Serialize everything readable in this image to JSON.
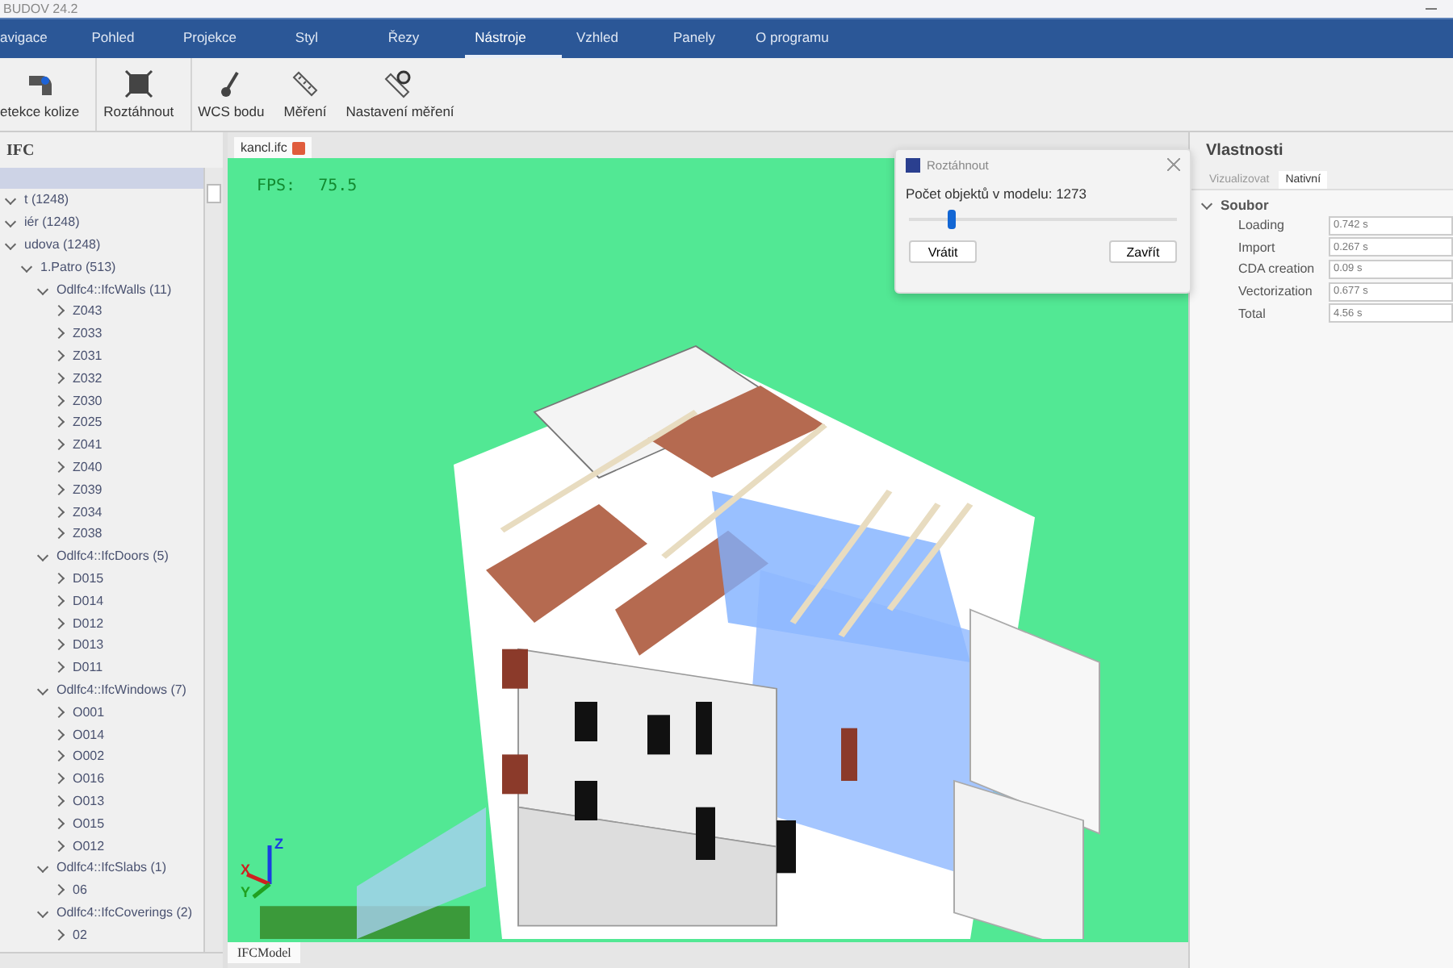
{
  "window": {
    "title": "BUDOV 24.2"
  },
  "menu": [
    {
      "label": "avigace",
      "selected": false
    },
    {
      "label": "Pohled",
      "selected": false
    },
    {
      "label": "Projekce",
      "selected": false
    },
    {
      "label": "Styl",
      "selected": false
    },
    {
      "label": "Řezy",
      "selected": false
    },
    {
      "label": "Nástroje",
      "selected": true
    },
    {
      "label": "Vzhled",
      "selected": false
    },
    {
      "label": "Panely",
      "selected": false
    },
    {
      "label": "O programu",
      "selected": false
    }
  ],
  "ribbon_groups": [
    {
      "buttons": [
        {
          "label": "etekce kolize",
          "kind": "collision"
        }
      ]
    },
    {
      "buttons": [
        {
          "label": "Roztáhnout",
          "kind": "explode"
        }
      ]
    },
    {
      "buttons": [
        {
          "label": "WCS bodu",
          "kind": "pin"
        },
        {
          "label": "Měření",
          "kind": "ruler"
        },
        {
          "label": "Nastavení měření",
          "kind": "ruler-settings"
        }
      ]
    }
  ],
  "left_panel": {
    "title": "IFC",
    "tree": [
      {
        "label": "t (1248)",
        "expanded": true,
        "children": [
          {
            "label": "iér (1248)",
            "expanded": true,
            "children": [
              {
                "label": "udova (1248)",
                "expanded": true,
                "children": [
                  {
                    "label": "1.Patro (513)",
                    "expanded": true,
                    "children": [
                      {
                        "label": "Odlfc4::IfcWalls (11)",
                        "expanded": true,
                        "children": [
                          {
                            "label": "Z043",
                            "expanded": false
                          },
                          {
                            "label": "Z033",
                            "expanded": false
                          },
                          {
                            "label": "Z031",
                            "expanded": false
                          },
                          {
                            "label": "Z032",
                            "expanded": false
                          },
                          {
                            "label": "Z030",
                            "expanded": false
                          },
                          {
                            "label": "Z025",
                            "expanded": false
                          },
                          {
                            "label": "Z041",
                            "expanded": false
                          },
                          {
                            "label": "Z040",
                            "expanded": false
                          },
                          {
                            "label": "Z039",
                            "expanded": false
                          },
                          {
                            "label": "Z034",
                            "expanded": false
                          },
                          {
                            "label": "Z038",
                            "expanded": false
                          }
                        ]
                      },
                      {
                        "label": "Odlfc4::IfcDoors (5)",
                        "expanded": true,
                        "children": [
                          {
                            "label": "D015",
                            "expanded": false
                          },
                          {
                            "label": "D014",
                            "expanded": false
                          },
                          {
                            "label": "D012",
                            "expanded": false
                          },
                          {
                            "label": "D013",
                            "expanded": false
                          },
                          {
                            "label": "D011",
                            "expanded": false
                          }
                        ]
                      },
                      {
                        "label": "Odlfc4::IfcWindows (7)",
                        "expanded": true,
                        "children": [
                          {
                            "label": "O001",
                            "expanded": false
                          },
                          {
                            "label": "O014",
                            "expanded": false
                          },
                          {
                            "label": "O002",
                            "expanded": false
                          },
                          {
                            "label": "O016",
                            "expanded": false
                          },
                          {
                            "label": "O013",
                            "expanded": false
                          },
                          {
                            "label": "O015",
                            "expanded": false
                          },
                          {
                            "label": "O012",
                            "expanded": false
                          }
                        ]
                      },
                      {
                        "label": "Odlfc4::IfcSlabs (1)",
                        "expanded": true,
                        "children": [
                          {
                            "label": "06",
                            "expanded": false
                          }
                        ]
                      },
                      {
                        "label": "Odlfc4::IfcCoverings (2)",
                        "expanded": true,
                        "children": [
                          {
                            "label": "02",
                            "expanded": false
                          }
                        ]
                      }
                    ]
                  }
                ]
              }
            ]
          }
        ]
      }
    ]
  },
  "document_tab": {
    "label": "kancl.ifc"
  },
  "viewport": {
    "fps_label": "FPS:",
    "fps": "75.5",
    "axes": [
      "X",
      "Y",
      "Z"
    ]
  },
  "bottom_tab": {
    "label": "IFCModel"
  },
  "dialog": {
    "title": "Roztáhnout",
    "message": "Počet objektů v modelu: 1273",
    "level": 0.16,
    "buttons": [
      "Vrátit",
      "Zavřít"
    ]
  },
  "properties": {
    "title": "Vlastnosti",
    "tabs": [
      {
        "label": "Vizualizovat",
        "selected": false
      },
      {
        "label": "Nativní",
        "selected": true
      }
    ],
    "group": {
      "label": "Soubor",
      "expanded": true
    },
    "rows": [
      {
        "name": "Loading",
        "value": "0.742 s"
      },
      {
        "name": "Import",
        "value": "0.267 s"
      },
      {
        "name": "CDA creation",
        "value": "0.09 s"
      },
      {
        "name": "Vectorization",
        "value": "0.677 s"
      },
      {
        "name": "Total",
        "value": "4.56 s"
      }
    ]
  }
}
